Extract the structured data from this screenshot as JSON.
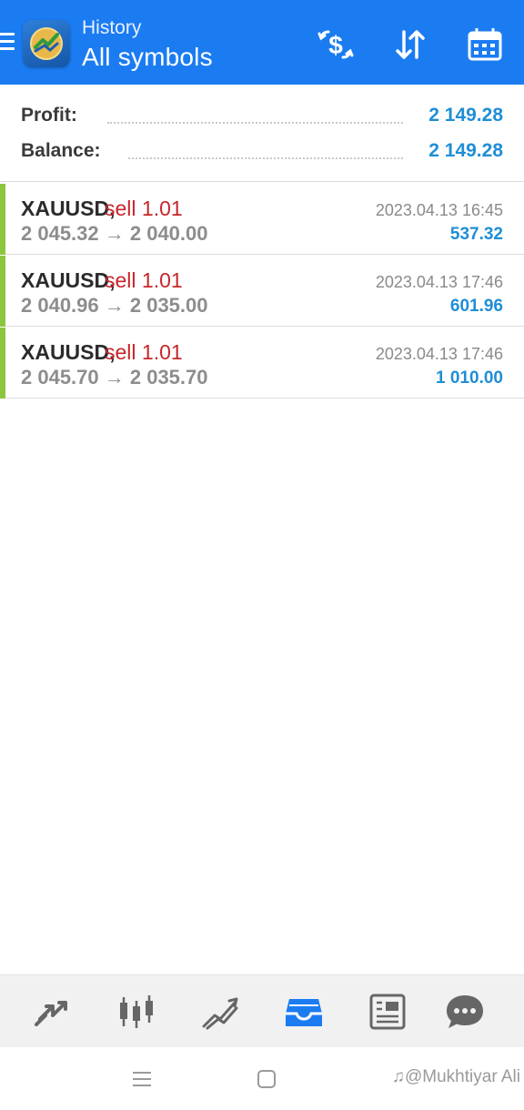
{
  "header": {
    "subtitle": "History",
    "title": "All symbols",
    "background_color": "#1b7cf2",
    "icons": [
      "menu-icon",
      "app-logo",
      "dollar-swap-icon",
      "sort-icon",
      "calendar-icon"
    ]
  },
  "summary": {
    "profit_label": "Profit:",
    "profit_value": "2 149.28",
    "balance_label": "Balance:",
    "balance_value": "2 149.28",
    "value_color": "#1f8ed6"
  },
  "deals": [
    {
      "symbol": "XAUUSD,",
      "type": "sell 1.01",
      "prices": "2 045.32 → 2 040.00",
      "time": "2023.04.13 16:45",
      "profit": "537.32"
    },
    {
      "symbol": "XAUUSD,",
      "type": "sell 1.01",
      "prices": "2 040.96 → 2 035.00",
      "time": "2023.04.13 17:46",
      "profit": "601.96"
    },
    {
      "symbol": "XAUUSD,",
      "type": "sell 1.01",
      "prices": "2 045.70 → 2 035.70",
      "time": "2023.04.13 17:46",
      "profit": "1 010.00"
    }
  ],
  "deal_colors": {
    "bar": "#8cc63e",
    "sell": "#c8252b",
    "profit": "#1f8ed6"
  },
  "bottom_nav": {
    "items": [
      "quotes-icon",
      "chart-icon",
      "trade-icon",
      "history-icon",
      "news-icon",
      "chat-icon"
    ],
    "active": "history-icon",
    "active_color": "#1b7cf2"
  },
  "system_bar": {
    "buttons": [
      "recent-apps-icon",
      "home-icon"
    ],
    "watermark": "@Mukhtiyar Ali"
  }
}
